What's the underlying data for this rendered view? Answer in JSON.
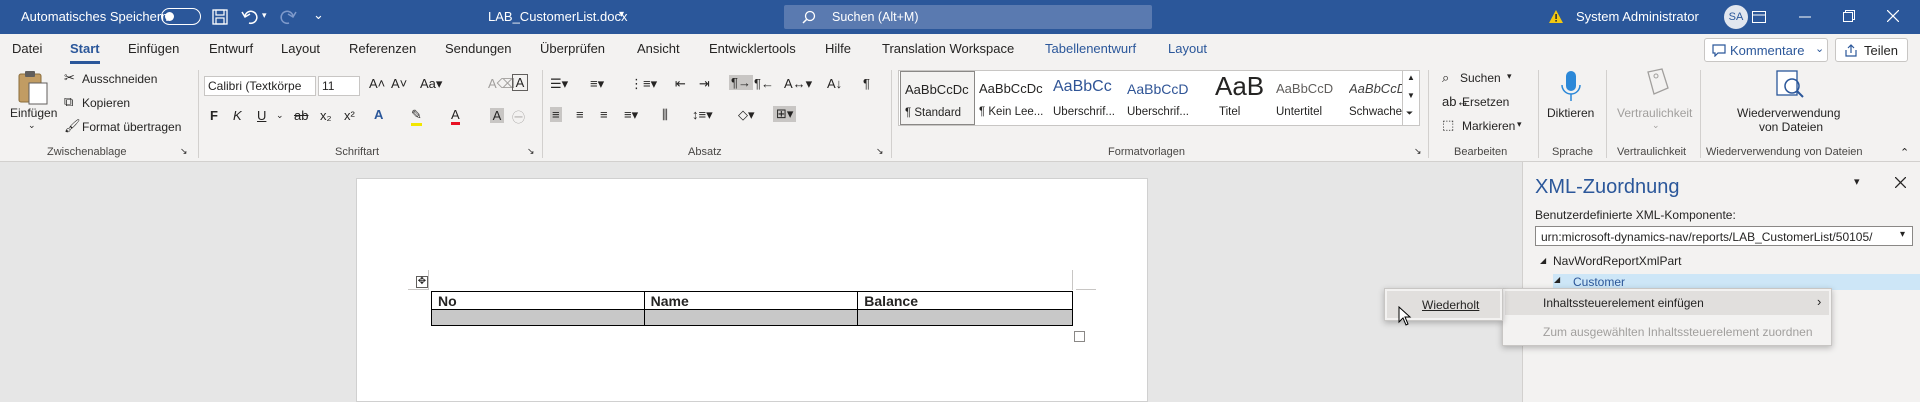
{
  "titlebar": {
    "autosave_label": "Automatisches Speichern",
    "doc_title": "LAB_CustomerList.docx",
    "search_placeholder": "Suchen (Alt+M)",
    "user_name": "System Administrator",
    "user_initials": "SA",
    "colors": {
      "bg": "#2b579a"
    }
  },
  "tabs": {
    "items": [
      "Datei",
      "Start",
      "Einfügen",
      "Entwurf",
      "Layout",
      "Referenzen",
      "Sendungen",
      "Überprüfen",
      "Ansicht",
      "Entwicklertools",
      "Hilfe",
      "Translation Workspace",
      "Tabellenentwurf",
      "Layout"
    ],
    "active": "Start",
    "comments_label": "Kommentare",
    "share_label": "Teilen"
  },
  "ribbon": {
    "clipboard": {
      "paste": "Einfügen",
      "cut": "Ausschneiden",
      "copy": "Kopieren",
      "format_painter": "Format übertragen",
      "group": "Zwischenablage"
    },
    "font": {
      "font_name": "Calibri (Textkörpe",
      "font_size": "11",
      "group": "Schriftart"
    },
    "paragraph": {
      "group": "Absatz"
    },
    "styles": {
      "group": "Formatvorlagen",
      "items": [
        {
          "preview": "AaBbCcDc",
          "name": "¶ Standard"
        },
        {
          "preview": "AaBbCcDc",
          "name": "¶ Kein Lee..."
        },
        {
          "preview": "AaBbCc",
          "name": "Überschrif..."
        },
        {
          "preview": "AaBbCcD",
          "name": "Überschrif..."
        },
        {
          "preview": "AaB",
          "name": "Titel"
        },
        {
          "preview": "AaBbCcD",
          "name": "Untertitel"
        },
        {
          "preview": "AaBbCcDc",
          "name": "Schwache..."
        }
      ]
    },
    "editing": {
      "search": "Suchen",
      "replace": "Ersetzen",
      "select": "Markieren",
      "group": "Bearbeiten"
    },
    "voice": {
      "dictate": "Diktieren",
      "group": "Sprache"
    },
    "sensitivity": {
      "label": "Vertraulichkeit",
      "group": "Vertraulichkeit"
    },
    "reuse": {
      "label_line1": "Wiederverwendung",
      "label_line2": "von Dateien",
      "group": "Wiederverwendung von Dateien"
    }
  },
  "document": {
    "table": {
      "headers": [
        "No",
        "Name",
        "Balance"
      ]
    }
  },
  "xml_pane": {
    "title": "XML-Zuordnung",
    "component_label": "Benutzerdefinierte XML-Komponente:",
    "component_value": "urn:microsoft-dynamics-nav/reports/LAB_CustomerList/50105/",
    "tree_root": "NavWordReportXmlPart",
    "tree_child": "Customer"
  },
  "context_menu": {
    "insert_content_control": "Inhaltssteuerelement einfügen",
    "map_to_selected": "Zum ausgewählten Inhaltssteuerelement zuordnen",
    "submenu_repeating": "Wiederholt"
  }
}
